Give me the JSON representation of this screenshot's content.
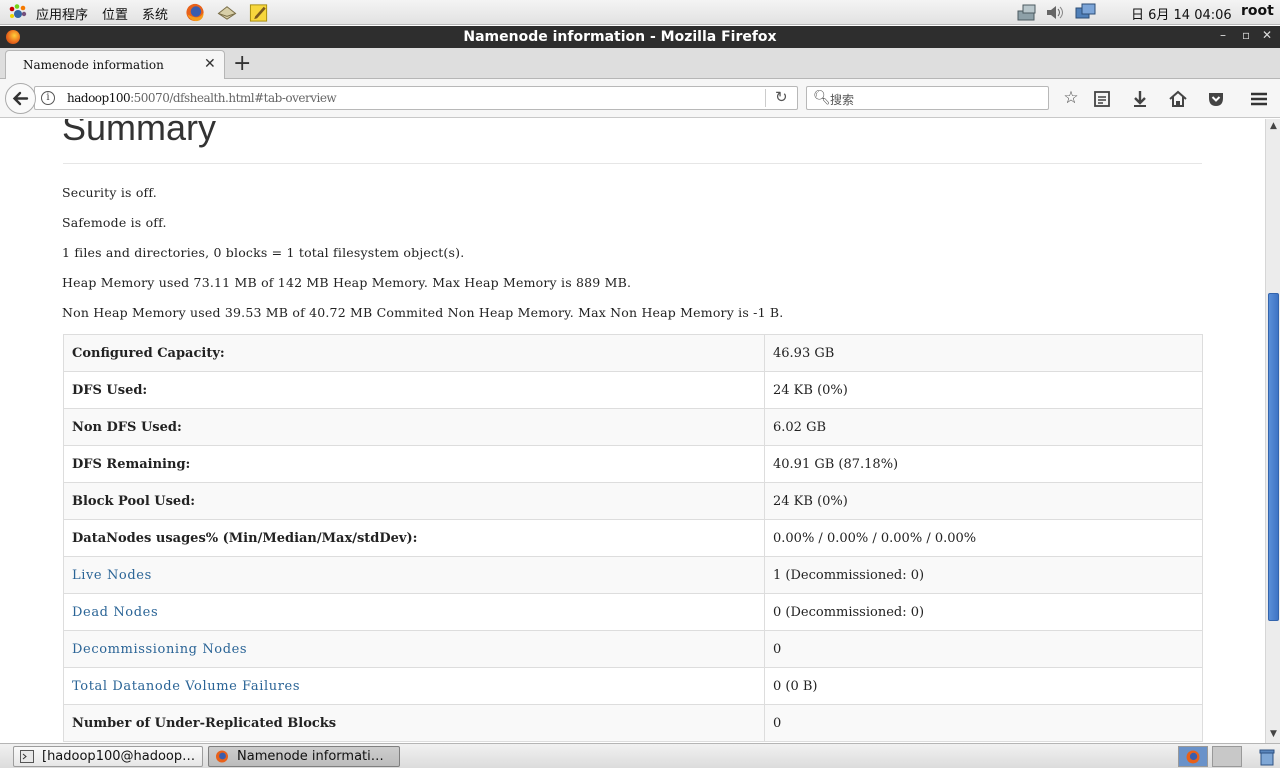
{
  "top_panel": {
    "menus": [
      "应用程序",
      "位置",
      "系统"
    ],
    "clock": "日 6月 14 04:06",
    "user": "root"
  },
  "window": {
    "title": "Namenode information - Mozilla Firefox",
    "controls": [
      "–",
      "▫",
      "✕"
    ]
  },
  "browser": {
    "tab_title": "Namenode information",
    "tab_close": "✕",
    "new_tab": "+",
    "url_host": "hadoop100",
    "url_rest": ":50070/dfshealth.html#tab-overview",
    "search_placeholder": "搜索",
    "toolbar_icons": [
      "star-icon",
      "reading-list-icon",
      "download-icon",
      "home-icon",
      "pocket-icon",
      "menu-icon"
    ]
  },
  "page": {
    "title": "Summary",
    "info_lines": [
      "Security is off.",
      "Safemode is off.",
      "1 files and directories, 0 blocks = 1 total filesystem object(s).",
      "Heap Memory used 73.11 MB of 142 MB Heap Memory. Max Heap Memory is 889 MB.",
      "Non Heap Memory used 39.53 MB of 40.72 MB Commited Non Heap Memory. Max Non Heap Memory is -1 B."
    ],
    "rows": [
      {
        "key": "Configured Capacity:",
        "value": "46.93 GB",
        "link": false
      },
      {
        "key": "DFS Used:",
        "value": "24 KB (0%)",
        "link": false
      },
      {
        "key": "Non DFS Used:",
        "value": "6.02 GB",
        "link": false
      },
      {
        "key": "DFS Remaining:",
        "value": "40.91 GB (87.18%)",
        "link": false
      },
      {
        "key": "Block Pool Used:",
        "value": "24 KB (0%)",
        "link": false
      },
      {
        "key": "DataNodes usages% (Min/Median/Max/stdDev):",
        "value": "0.00% / 0.00% / 0.00% / 0.00%",
        "link": false
      },
      {
        "key": "Live Nodes",
        "value": "1 (Decommissioned: 0)",
        "link": true
      },
      {
        "key": "Dead Nodes",
        "value": "0 (Decommissioned: 0)",
        "link": true
      },
      {
        "key": "Decommissioning Nodes",
        "value": "0",
        "link": true
      },
      {
        "key": "Total Datanode Volume Failures",
        "value": "0 (0 B)",
        "link": true
      },
      {
        "key": "Number of Under-Replicated Blocks",
        "value": "0",
        "link": false
      }
    ]
  },
  "taskbar": {
    "tasks": [
      {
        "label": "[hadoop100@hadoop…",
        "active": false,
        "icon": "terminal-icon"
      },
      {
        "label": "Namenode informati…",
        "active": true,
        "icon": "firefox-icon"
      }
    ]
  },
  "colors": {
    "link": "#2a6496",
    "scroll_thumb": "#4a80cc",
    "titlebar": "#2e2e2e"
  }
}
